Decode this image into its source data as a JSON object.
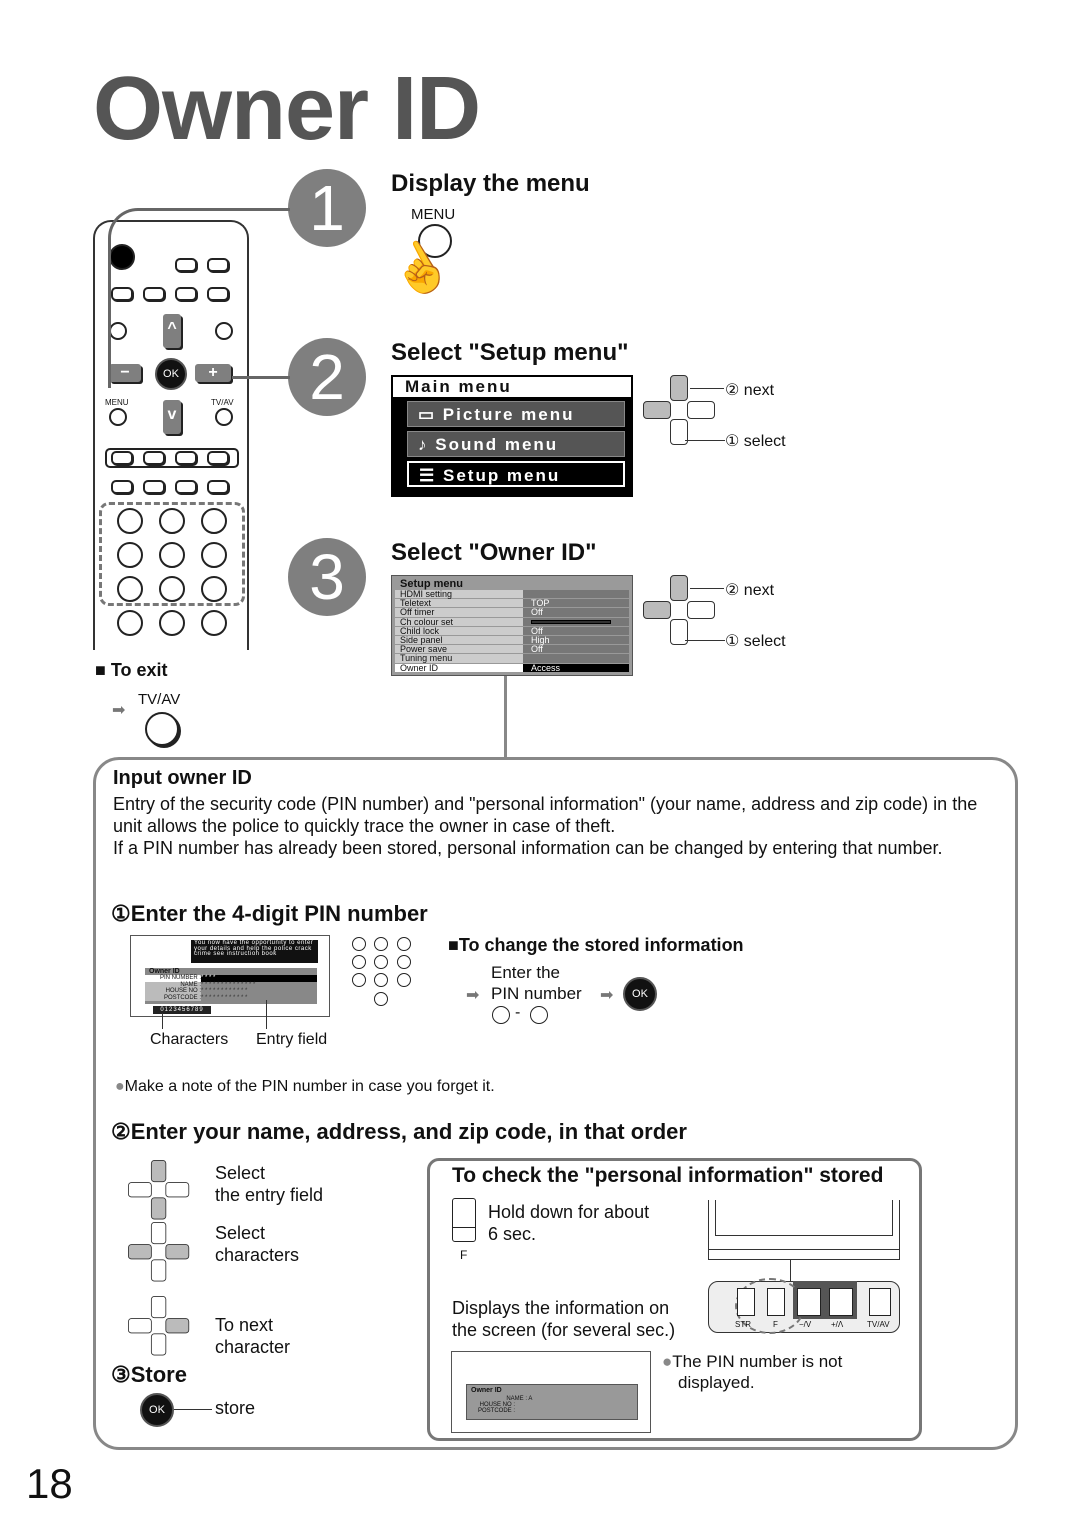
{
  "page_title": "Owner ID",
  "page_number": "18",
  "steps": [
    {
      "number": "1",
      "heading": "Display the menu",
      "button_label": "MENU"
    },
    {
      "number": "2",
      "heading": "Select \"Setup menu\"",
      "next_label": "② next",
      "select_label": "① select"
    },
    {
      "number": "3",
      "heading": "Select \"Owner ID\"",
      "next_label": "② next",
      "select_label": "① select"
    }
  ],
  "remote": {
    "ok": "OK",
    "menu": "MENU",
    "tvav": "TV/AV",
    "minus": "−",
    "plus": "+",
    "up": "^",
    "down": "v"
  },
  "main_menu": {
    "title": "Main menu",
    "items": [
      {
        "icon": "picture-icon",
        "glyph": "▭",
        "label": "Picture menu"
      },
      {
        "icon": "sound-icon",
        "glyph": "♪",
        "label": "Sound menu"
      },
      {
        "icon": "list-icon",
        "glyph": "☰",
        "label": "Setup menu",
        "selected": true
      }
    ]
  },
  "setup_menu": {
    "title": "Setup menu",
    "rows": [
      {
        "label": "HDMI setting",
        "value": ""
      },
      {
        "label": "Teletext",
        "value": "TOP"
      },
      {
        "label": "Off timer",
        "value": "Off"
      },
      {
        "label": "Ch colour set",
        "value": ""
      },
      {
        "label": "Child lock",
        "value": "Off"
      },
      {
        "label": "Side panel",
        "value": "High"
      },
      {
        "label": "Power save",
        "value": "Off"
      },
      {
        "label": "Tuning menu",
        "value": ""
      },
      {
        "label": "Owner ID",
        "value": "Access",
        "selected": true
      }
    ]
  },
  "exit": {
    "label": "To exit",
    "button": "TV/AV"
  },
  "input_section": {
    "heading": "Input owner ID",
    "paragraphs": [
      "Entry of the security code (PIN number) and \"personal information\" (your name, address and zip code) in the unit allows the police to quickly trace the owner in case of theft.",
      "If a PIN number has already been stored, personal information can be changed by entering that number."
    ],
    "step1": "①Enter the 4-digit PIN number",
    "pin_screen": {
      "message": "You now have the opportunity to enter your details and help the police crack crime see instruction book",
      "title": "Owner ID",
      "fields": [
        {
          "label": "PIN NUMBER :",
          "value": "* * * *"
        },
        {
          "label": "NAME :",
          "value": "* * * * * * * * * * * * * *"
        },
        {
          "label": "HOUSE NO :",
          "value": "* * * * * * * * * * * *"
        },
        {
          "label": "POSTCODE :",
          "value": "* * * * * * * * * * * *"
        }
      ],
      "characters": "0123456789"
    },
    "characters_label": "Characters",
    "entry_field_label": "Entry field",
    "change": {
      "heading": "To change the stored information",
      "line1": "Enter the",
      "line2": "PIN number",
      "ok": "OK",
      "range": "-"
    },
    "note": "Make a note of the PIN number in case you forget it.",
    "step2": "②Enter your name, address, and zip code, in that order",
    "instructions": [
      {
        "line1": "Select",
        "line2": "the entry field"
      },
      {
        "line1": "Select",
        "line2": "characters"
      },
      {
        "line1": "To next",
        "line2": "character"
      }
    ],
    "step3": "③Store",
    "store_ok": "OK",
    "store_label": "store"
  },
  "check": {
    "heading": "To check the \"personal information\" stored",
    "hold": "Hold down for about",
    "hold2": "6 sec.",
    "f_label": "F",
    "displays": "Displays the information on",
    "displays2": "the screen (for several sec.)",
    "panel_buttons": [
      "STR",
      "F",
      "−/V",
      "+/Λ",
      "TV/AV"
    ],
    "screen": {
      "title": "Owner ID",
      "name_label": "NAME :",
      "name_value": "A",
      "house_label": "HOUSE NO :",
      "postcode_label": "POSTCODE :"
    },
    "pin_note1": "The PIN number is not",
    "pin_note2": "displayed."
  }
}
